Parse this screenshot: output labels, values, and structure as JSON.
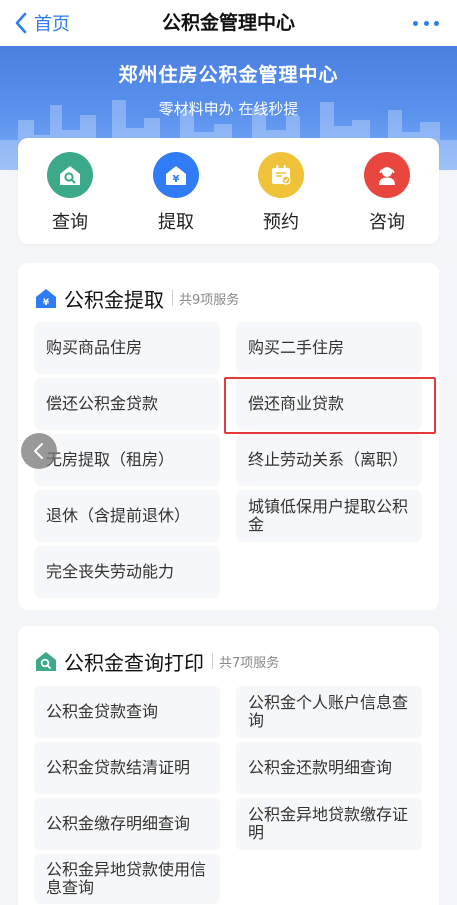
{
  "nav": {
    "back_label": "首页",
    "title": "公积金管理中心"
  },
  "banner": {
    "title": "郑州住房公积金管理中心",
    "subtitle": "零材料申办 在线秒提"
  },
  "quick_actions": [
    {
      "label": "查询",
      "icon": "home-search-icon",
      "color": "#3ba98a"
    },
    {
      "label": "提取",
      "icon": "home-yen-icon",
      "color": "#2f7cf6"
    },
    {
      "label": "预约",
      "icon": "calendar-check-icon",
      "color": "#f0c23a"
    },
    {
      "label": "咨询",
      "icon": "headset-agent-icon",
      "color": "#e9463f"
    }
  ],
  "withdrawal": {
    "title": "公积金提取",
    "count": "共9项服务",
    "items": [
      "购买商品住房",
      "购买二手住房",
      "偿还公积金贷款",
      "偿还商业贷款",
      "无房提取（租房）",
      "终止劳动关系（离职）",
      "退休（含提前退休）",
      "城镇低保用户提取公积金",
      "完全丧失劳动能力"
    ]
  },
  "query": {
    "title": "公积金查询打印",
    "count": "共7项服务",
    "items": [
      "公积金贷款查询",
      "公积金个人账户信息查询",
      "公积金贷款结清证明",
      "公积金还款明细查询",
      "公积金缴存明细查询",
      "公积金异地贷款缴存证明",
      "公积金异地贷款使用信息查询"
    ]
  },
  "colors": {
    "accent": "#2f7cf6",
    "highlight": "#e53a3a"
  }
}
